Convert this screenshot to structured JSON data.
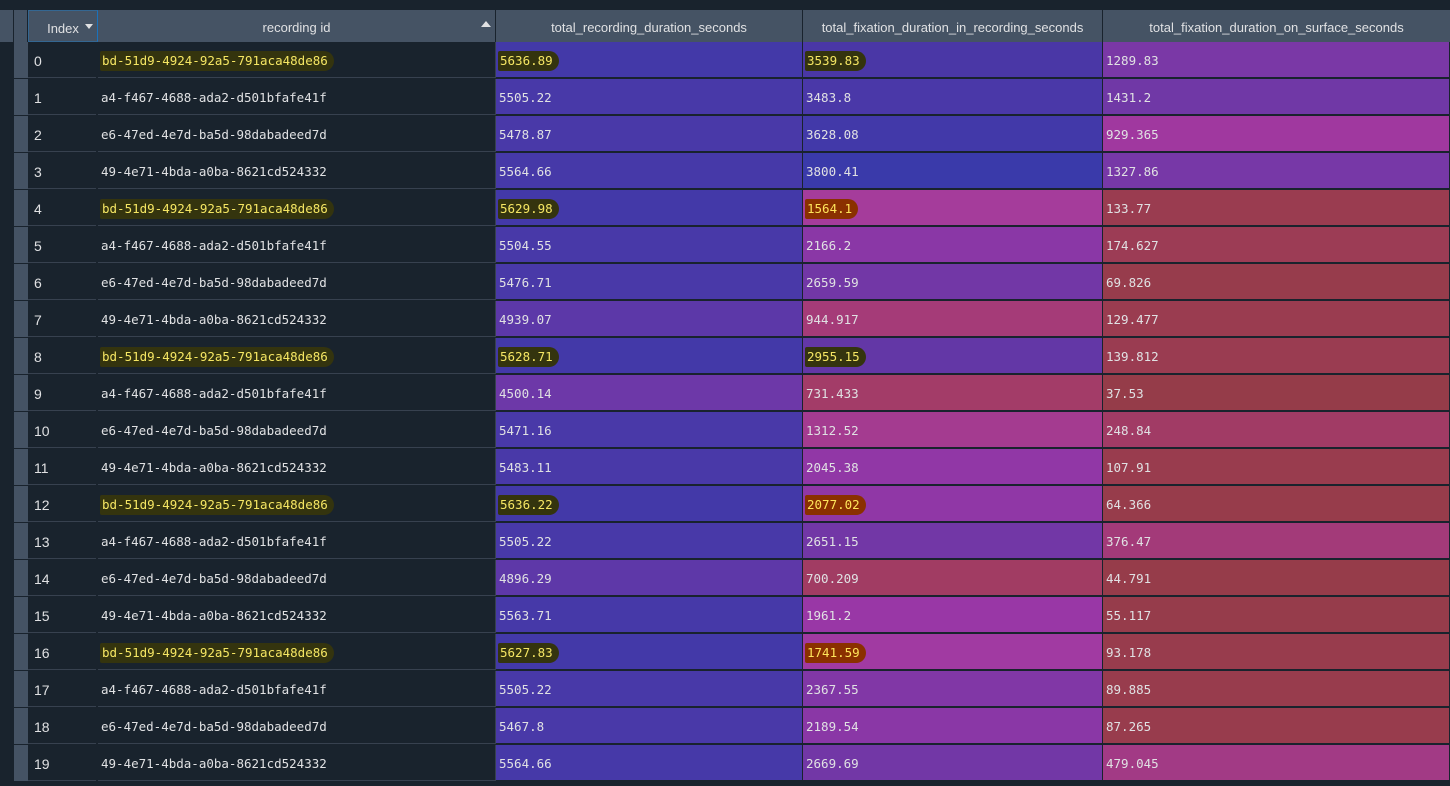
{
  "columns": {
    "index": "Index",
    "recording_id": "recording id",
    "duration": "total_recording_duration_seconds",
    "fixation": "total_fixation_duration_in_recording_seconds",
    "surface": "total_fixation_duration_on_surface_seconds"
  },
  "colors": {
    "background": "#19232d",
    "header": "#455364",
    "highlight_olive": "#34340e",
    "highlight_orange": "#8a3000"
  },
  "rows": [
    {
      "index": "0",
      "rec": "bd-51d9-4924-92a5-791aca48de86",
      "dur": "5636.89",
      "fix": "3539.83",
      "surf": "1289.83",
      "hl": true,
      "fix_hl": "olive",
      "c_dur": "#4339a8",
      "c_fix": "#4a37a6",
      "c_surf": "#7a38a6"
    },
    {
      "index": "1",
      "rec": "a4-f467-4688-ada2-d501bfafe41f",
      "dur": "5505.22",
      "fix": "3483.8",
      "surf": "1431.2",
      "hl": false,
      "fix_hl": "",
      "c_dur": "#4839a8",
      "c_fix": "#4a38a8",
      "c_surf": "#7038a6"
    },
    {
      "index": "2",
      "rec": "e6-47ed-4e7d-ba5d-98dabadeed7d",
      "dur": "5478.87",
      "fix": "3628.08",
      "surf": "929.365",
      "hl": false,
      "fix_hl": "",
      "c_dur": "#4939a8",
      "c_fix": "#4239a9",
      "c_surf": "#a0389f"
    },
    {
      "index": "3",
      "rec": "49-4e71-4bda-a0ba-8621cd524332",
      "dur": "5564.66",
      "fix": "3800.41",
      "surf": "1327.86",
      "hl": false,
      "fix_hl": "",
      "c_dur": "#4639a8",
      "c_fix": "#3a3aaa",
      "c_surf": "#7738a7"
    },
    {
      "index": "4",
      "rec": "bd-51d9-4924-92a5-791aca48de86",
      "dur": "5629.98",
      "fix": "1564.1",
      "surf": "133.77",
      "hl": true,
      "fix_hl": "orange",
      "c_dur": "#4339a8",
      "c_fix": "#a53c9b",
      "c_surf": "#9a3c50"
    },
    {
      "index": "5",
      "rec": "a4-f467-4688-ada2-d501bfafe41f",
      "dur": "5504.55",
      "fix": "2166.2",
      "surf": "174.627",
      "hl": false,
      "fix_hl": "",
      "c_dur": "#4839a8",
      "c_fix": "#8a37a6",
      "c_surf": "#9c3c55"
    },
    {
      "index": "6",
      "rec": "e6-47ed-4e7d-ba5d-98dabadeed7d",
      "dur": "5476.71",
      "fix": "2659.59",
      "surf": "69.826",
      "hl": false,
      "fix_hl": "",
      "c_dur": "#4939a8",
      "c_fix": "#7237a6",
      "c_surf": "#973c4c"
    },
    {
      "index": "7",
      "rec": "49-4e71-4bda-a0ba-8621cd524332",
      "dur": "4939.07",
      "fix": "944.917",
      "surf": "129.477",
      "hl": false,
      "fix_hl": "",
      "c_dur": "#5c38a8",
      "c_fix": "#a53b78",
      "c_surf": "#9a3c50"
    },
    {
      "index": "8",
      "rec": "bd-51d9-4924-92a5-791aca48de86",
      "dur": "5628.71",
      "fix": "2955.15",
      "surf": "139.812",
      "hl": true,
      "fix_hl": "olive",
      "c_dur": "#4339a8",
      "c_fix": "#6337a6",
      "c_surf": "#9a3c51"
    },
    {
      "index": "9",
      "rec": "a4-f467-4688-ada2-d501bfafe41f",
      "dur": "4500.14",
      "fix": "731.433",
      "surf": "37.53",
      "hl": false,
      "fix_hl": "",
      "c_dur": "#6d38a8",
      "c_fix": "#a33c68",
      "c_surf": "#953c49"
    },
    {
      "index": "10",
      "rec": "e6-47ed-4e7d-ba5d-98dabadeed7d",
      "dur": "5471.16",
      "fix": "1312.52",
      "surf": "248.84",
      "hl": false,
      "fix_hl": "",
      "c_dur": "#4939a8",
      "c_fix": "#a43b90",
      "c_surf": "#a13b65"
    },
    {
      "index": "11",
      "rec": "49-4e71-4bda-a0ba-8621cd524332",
      "dur": "5483.11",
      "fix": "2045.38",
      "surf": "107.91",
      "hl": false,
      "fix_hl": "",
      "c_dur": "#4939a8",
      "c_fix": "#9137a6",
      "c_surf": "#993c4e"
    },
    {
      "index": "12",
      "rec": "bd-51d9-4924-92a5-791aca48de86",
      "dur": "5636.22",
      "fix": "2077.02",
      "surf": "64.366",
      "hl": true,
      "fix_hl": "orange",
      "c_dur": "#4339a8",
      "c_fix": "#9037a6",
      "c_surf": "#973c4b"
    },
    {
      "index": "13",
      "rec": "a4-f467-4688-ada2-d501bfafe41f",
      "dur": "5505.22",
      "fix": "2651.15",
      "surf": "376.47",
      "hl": false,
      "fix_hl": "",
      "c_dur": "#4839a8",
      "c_fix": "#7237a6",
      "c_surf": "#a33a79"
    },
    {
      "index": "14",
      "rec": "e6-47ed-4e7d-ba5d-98dabadeed7d",
      "dur": "4896.29",
      "fix": "700.209",
      "surf": "44.791",
      "hl": false,
      "fix_hl": "",
      "c_dur": "#5e38a8",
      "c_fix": "#a13c63",
      "c_surf": "#963c4a"
    },
    {
      "index": "15",
      "rec": "49-4e71-4bda-a0ba-8621cd524332",
      "dur": "5563.71",
      "fix": "1961.2",
      "surf": "55.117",
      "hl": false,
      "fix_hl": "",
      "c_dur": "#4639a8",
      "c_fix": "#9937a6",
      "c_surf": "#963c4b"
    },
    {
      "index": "16",
      "rec": "bd-51d9-4924-92a5-791aca48de86",
      "dur": "5627.83",
      "fix": "1741.59",
      "surf": "93.178",
      "hl": true,
      "fix_hl": "orange",
      "c_dur": "#4339a8",
      "c_fix": "#a13aa2",
      "c_surf": "#983c4d"
    },
    {
      "index": "17",
      "rec": "a4-f467-4688-ada2-d501bfafe41f",
      "dur": "5505.22",
      "fix": "2367.55",
      "surf": "89.885",
      "hl": false,
      "fix_hl": "",
      "c_dur": "#4839a8",
      "c_fix": "#8137a6",
      "c_surf": "#983c4d"
    },
    {
      "index": "18",
      "rec": "e6-47ed-4e7d-ba5d-98dabadeed7d",
      "dur": "5467.8",
      "fix": "2189.54",
      "surf": "87.265",
      "hl": false,
      "fix_hl": "",
      "c_dur": "#4939a8",
      "c_fix": "#8a37a6",
      "c_surf": "#983c4d"
    },
    {
      "index": "19",
      "rec": "49-4e71-4bda-a0ba-8621cd524332",
      "dur": "5564.66",
      "fix": "2669.69",
      "surf": "479.045",
      "hl": false,
      "fix_hl": "",
      "c_dur": "#4639a8",
      "c_fix": "#7237a6",
      "c_surf": "#a23a85"
    }
  ]
}
